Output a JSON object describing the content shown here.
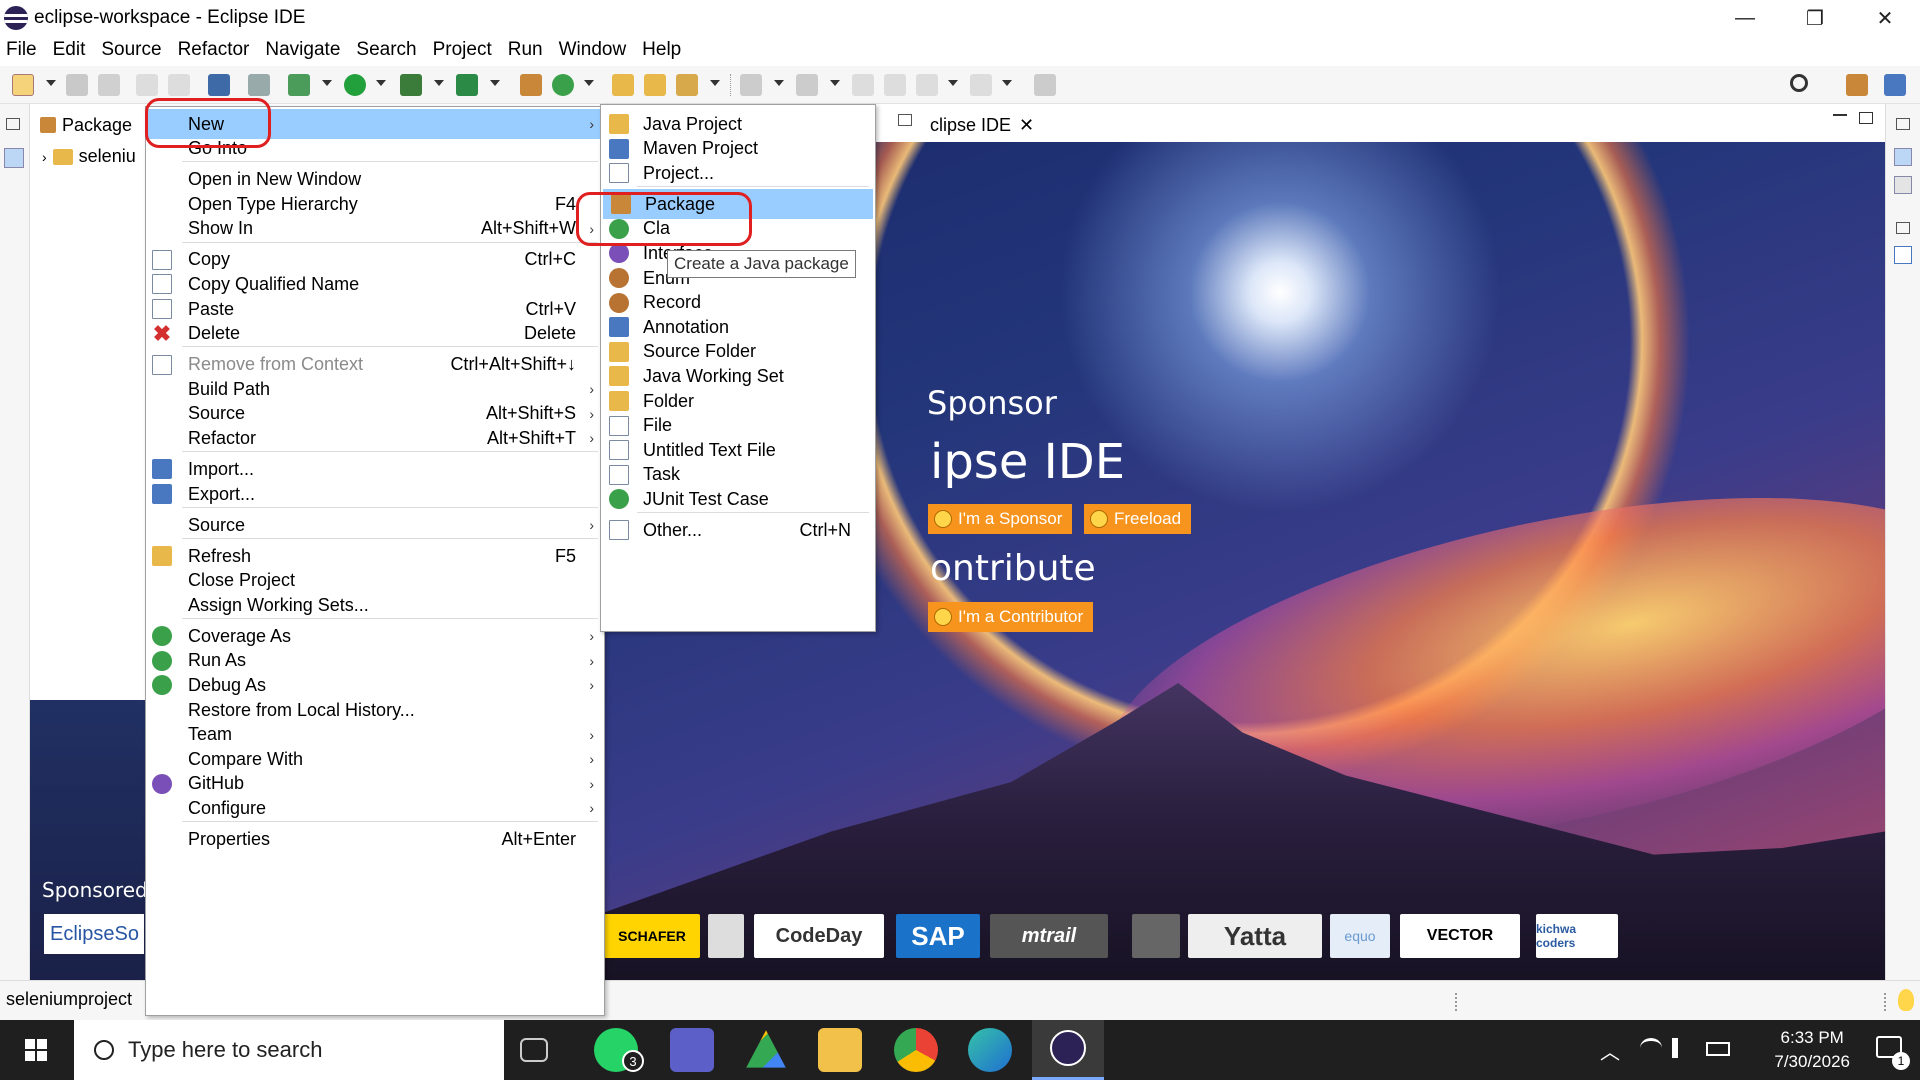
{
  "window": {
    "title": "eclipse-workspace - Eclipse IDE",
    "minimize_glyph": "—",
    "restore_glyph": "❐",
    "close_glyph": "✕"
  },
  "menubar": [
    "File",
    "Edit",
    "Source",
    "Refactor",
    "Navigate",
    "Search",
    "Project",
    "Run",
    "Window",
    "Help"
  ],
  "package_explorer": {
    "tab_label": "Package",
    "tree_item": "seleniu"
  },
  "editor": {
    "tab_label": "clipse IDE",
    "tab_close": "✕"
  },
  "welcome": {
    "heading1": "Sponsor",
    "heading2": "ipse IDE",
    "btn_sponsor": "I'm a Sponsor",
    "btn_freeload": "Freeload",
    "heading3": "ontribute",
    "btn_contributor": "I'm a Contributor",
    "sponsored_label": "Sponsored",
    "sponsors": [
      "EclipseSo",
      "SCHAFER",
      "CodeDay",
      "SAP",
      "mtrail",
      "Yatta",
      "equo",
      "VECTOR",
      "kichwa coders"
    ]
  },
  "context_menu": [
    {
      "label": "New",
      "arrow": true,
      "highlighted": true
    },
    {
      "label": "Go Into"
    },
    {
      "sep": true
    },
    {
      "label": "Open in New Window"
    },
    {
      "label": "Open Type Hierarchy",
      "shortcut": "F4"
    },
    {
      "label": "Show In",
      "shortcut": "Alt+Shift+W",
      "arrow": true
    },
    {
      "sep": true
    },
    {
      "label": "Copy",
      "shortcut": "Ctrl+C",
      "icon": "copy-icon"
    },
    {
      "label": "Copy Qualified Name",
      "icon": "copy-qualified-icon"
    },
    {
      "label": "Paste",
      "shortcut": "Ctrl+V",
      "icon": "paste-icon"
    },
    {
      "label": "Delete",
      "shortcut": "Delete",
      "icon": "delete-icon"
    },
    {
      "sep": true
    },
    {
      "label": "Remove from Context",
      "shortcut": "Ctrl+Alt+Shift+↓",
      "disabled": true,
      "icon": "remove-context-icon"
    },
    {
      "label": "Build Path",
      "arrow": true
    },
    {
      "label": "Source",
      "shortcut": "Alt+Shift+S",
      "arrow": true
    },
    {
      "label": "Refactor",
      "shortcut": "Alt+Shift+T",
      "arrow": true
    },
    {
      "sep": true
    },
    {
      "label": "Import...",
      "icon": "import-icon"
    },
    {
      "label": "Export...",
      "icon": "export-icon"
    },
    {
      "sep": true
    },
    {
      "label": "Source",
      "arrow": true
    },
    {
      "sep": true
    },
    {
      "label": "Refresh",
      "shortcut": "F5",
      "icon": "refresh-icon"
    },
    {
      "label": "Close Project"
    },
    {
      "label": "Assign Working Sets..."
    },
    {
      "sep": true
    },
    {
      "label": "Coverage As",
      "arrow": true,
      "icon": "coverage-icon"
    },
    {
      "label": "Run As",
      "arrow": true,
      "icon": "run-icon"
    },
    {
      "label": "Debug As",
      "arrow": true,
      "icon": "debug-icon"
    },
    {
      "label": "Restore from Local History..."
    },
    {
      "label": "Team",
      "arrow": true
    },
    {
      "label": "Compare With",
      "arrow": true
    },
    {
      "label": "GitHub",
      "arrow": true,
      "icon": "github-icon"
    },
    {
      "label": "Configure",
      "arrow": true
    },
    {
      "sep": true
    },
    {
      "label": "Properties",
      "shortcut": "Alt+Enter"
    }
  ],
  "new_submenu": [
    {
      "label": "Java Project",
      "icon": "java-project-icon"
    },
    {
      "label": "Maven Project",
      "icon": "maven-project-icon"
    },
    {
      "label": "Project...",
      "icon": "project-icon"
    },
    {
      "sep": true
    },
    {
      "label": "Package",
      "icon": "package-icon",
      "highlighted": true
    },
    {
      "label": "Cla",
      "icon": "class-icon"
    },
    {
      "label": "Interface",
      "icon": "interface-icon"
    },
    {
      "label": "Enum",
      "icon": "enum-icon"
    },
    {
      "label": "Record",
      "icon": "record-icon"
    },
    {
      "label": "Annotation",
      "icon": "annotation-icon"
    },
    {
      "label": "Source Folder",
      "icon": "source-folder-icon"
    },
    {
      "label": "Java Working Set",
      "icon": "working-set-icon"
    },
    {
      "label": "Folder",
      "icon": "folder-icon"
    },
    {
      "label": "File",
      "icon": "file-icon"
    },
    {
      "label": "Untitled Text File",
      "icon": "text-file-icon"
    },
    {
      "label": "Task",
      "icon": "task-icon"
    },
    {
      "label": "JUnit Test Case",
      "icon": "junit-icon"
    },
    {
      "sep": true
    },
    {
      "label": "Other...",
      "shortcut": "Ctrl+N",
      "icon": "other-icon"
    }
  ],
  "tooltip": "Create a Java package",
  "statusbar": {
    "text": "seleniumproject"
  },
  "taskbar": {
    "search_placeholder": "Type here to search",
    "whatsapp_badge": "3",
    "time": "6:33 PM",
    "date": "7/30/2026",
    "notification_count": "1"
  }
}
